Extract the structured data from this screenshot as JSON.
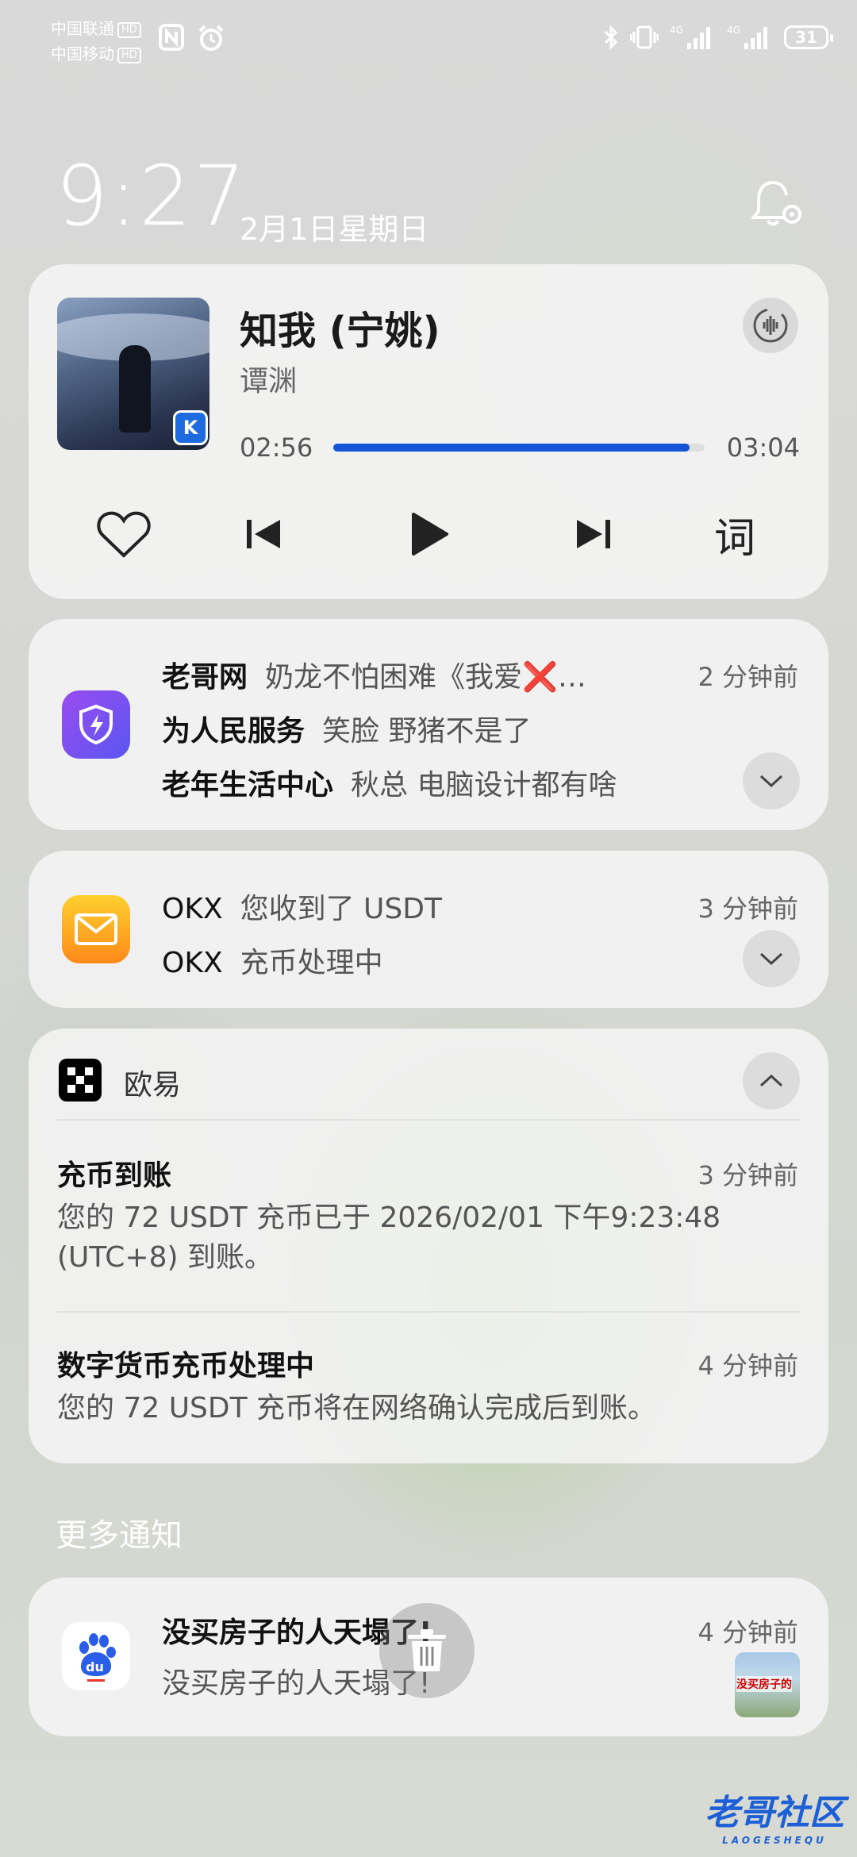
{
  "status_bar": {
    "carrier1": "中国联通",
    "carrier2": "中国移动",
    "hd": "HD",
    "battery": "31"
  },
  "lockscreen": {
    "time": "9:27",
    "date": "2月1日星期日"
  },
  "media": {
    "title": "知我 (宁姚)",
    "artist": "谭渊",
    "current_time": "02:56",
    "total_time": "03:04",
    "progress": 0.96,
    "lyrics_label": "词",
    "accent": "#1656d6"
  },
  "group1": {
    "time": "2 分钟前",
    "rows": [
      {
        "source": "老哥网",
        "message": "奶龙不怕困难《我爱❌…"
      },
      {
        "source": "为人民服务",
        "message": "笑脸 野猪不是了"
      },
      {
        "source": "老年生活中心",
        "message": "秋总 电脑设计都有啥"
      }
    ]
  },
  "group2": {
    "time": "3 分钟前",
    "rows": [
      {
        "source": "OKX",
        "message": "您收到了 USDT"
      },
      {
        "source": "OKX",
        "message": "充币处理中"
      }
    ]
  },
  "okx": {
    "app_name": "欧易",
    "items": [
      {
        "title": "充币到账",
        "time": "3 分钟前",
        "body": "您的 72 USDT 充币已于 2026/02/01 下午9:23:48 (UTC+8) 到账。"
      },
      {
        "title": "数字货币充币处理中",
        "time": "4 分钟前",
        "body": "您的 72 USDT 充币将在网络确认完成后到账。"
      }
    ]
  },
  "more": {
    "label": "更多通知",
    "title": "没买房子的人天塌了!",
    "body": "没买房子的人天塌了!",
    "time": "4 分钟前",
    "thumb_text": "没买房子的"
  },
  "watermark": {
    "text": "老哥社区",
    "sub": "LAOGESHEQU"
  }
}
